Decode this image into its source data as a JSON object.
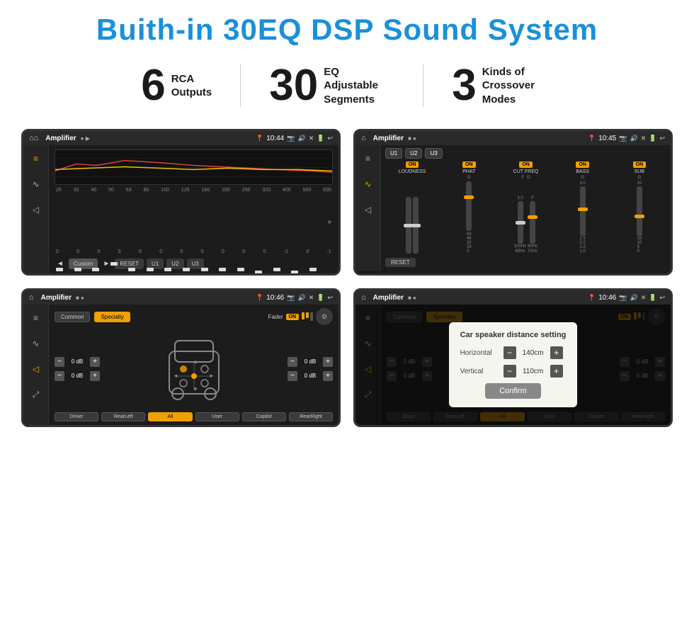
{
  "header": {
    "title": "Buith-in 30EQ DSP Sound System"
  },
  "stats": [
    {
      "number": "6",
      "label": "RCA\nOutputs"
    },
    {
      "number": "30",
      "label": "EQ Adjustable\nSegments"
    },
    {
      "number": "3",
      "label": "Kinds of\nCrossover Modes"
    }
  ],
  "screens": [
    {
      "id": "screen1",
      "status_bar": {
        "app": "Amplifier",
        "time": "10:44"
      },
      "type": "eq",
      "freq_labels": [
        "25",
        "32",
        "40",
        "50",
        "63",
        "80",
        "100",
        "125",
        "160",
        "200",
        "250",
        "320",
        "400",
        "500",
        "630"
      ],
      "eq_values": [
        "0",
        "0",
        "0",
        "5",
        "0",
        "0",
        "0",
        "0",
        "0",
        "0",
        "0",
        "-1",
        "0",
        "-1"
      ],
      "controls": [
        "Custom",
        "RESET",
        "U1",
        "U2",
        "U3"
      ]
    },
    {
      "id": "screen2",
      "status_bar": {
        "app": "Amplifier",
        "time": "10:45"
      },
      "type": "amp",
      "presets": [
        "U1",
        "U2",
        "U3"
      ],
      "channels": [
        {
          "label": "LOUDNESS",
          "on": true
        },
        {
          "label": "PHAT",
          "on": true
        },
        {
          "label": "CUT FREQ",
          "on": true
        },
        {
          "label": "BASS",
          "on": true
        },
        {
          "label": "SUB",
          "on": true
        }
      ]
    },
    {
      "id": "screen3",
      "status_bar": {
        "app": "Amplifier",
        "time": "10:46"
      },
      "type": "speaker",
      "tabs": [
        "Common",
        "Specialty"
      ],
      "active_tab": "Specialty",
      "fader_label": "Fader",
      "fader_on": true,
      "volumes": [
        {
          "label": "",
          "value": "0 dB"
        },
        {
          "label": "",
          "value": "0 dB"
        },
        {
          "label": "",
          "value": "0 dB"
        },
        {
          "label": "",
          "value": "0 dB"
        }
      ],
      "footer_btns": [
        "Driver",
        "RearLeft",
        "All",
        "User",
        "Copilot",
        "RearRight"
      ]
    },
    {
      "id": "screen4",
      "status_bar": {
        "app": "Amplifier",
        "time": "10:46"
      },
      "type": "speaker-dialog",
      "tabs": [
        "Common",
        "Specialty"
      ],
      "active_tab": "Specialty",
      "dialog": {
        "title": "Car speaker distance setting",
        "fields": [
          {
            "label": "Horizontal",
            "value": "140cm"
          },
          {
            "label": "Vertical",
            "value": "110cm"
          }
        ],
        "confirm_label": "Confirm"
      },
      "side_values": [
        {
          "value": "0 dB"
        },
        {
          "value": "0 dB"
        }
      ],
      "footer_btns": [
        "Driver",
        "RearLeft.",
        "All",
        "User",
        "Copilot",
        "RearRight"
      ]
    }
  ]
}
